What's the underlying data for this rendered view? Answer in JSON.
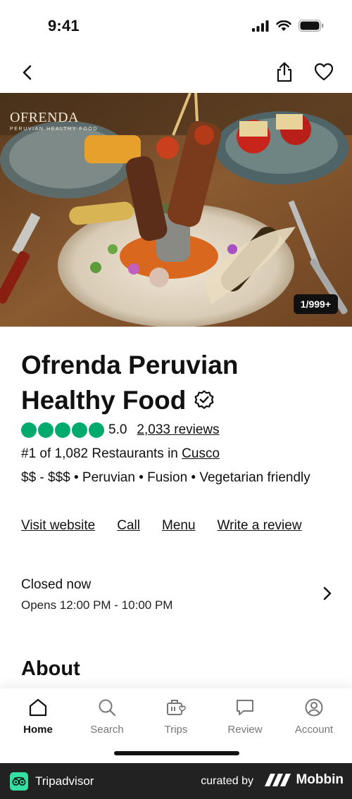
{
  "status_bar": {
    "time": "9:41",
    "icons": [
      "signal-icon",
      "wifi-icon",
      "battery-icon"
    ]
  },
  "nav": {
    "back_icon": "chevron-left-icon",
    "share_icon": "share-icon",
    "favorite_icon": "heart-icon"
  },
  "hero": {
    "photo_counter": "1/999+",
    "logo_text": "OFRENDA",
    "logo_subtext": "PERUVIAN HEALTHY FOOD"
  },
  "restaurant": {
    "name": "Ofrenda Peruvian Healthy Food",
    "verified_icon": "verified-badge-icon",
    "rating": "5.0",
    "rating_bubbles": 5,
    "review_count": "2,033 reviews",
    "ranking_prefix": "#1 of 1,082 Restaurants in ",
    "ranking_city": "Cusco",
    "tags": "$$ - $$$ • Peruvian • Fusion • Vegetarian friendly"
  },
  "actions": {
    "visit_website": "Visit website",
    "call": "Call",
    "menu": "Menu",
    "write_review": "Write a review"
  },
  "hours": {
    "status": "Closed now",
    "detail": "Opens 12:00 PM - 10:00 PM"
  },
  "about": {
    "heading": "About"
  },
  "tabs": [
    {
      "label": "Home",
      "icon": "home-icon",
      "active": true
    },
    {
      "label": "Search",
      "icon": "search-icon",
      "active": false
    },
    {
      "label": "Trips",
      "icon": "trips-icon",
      "active": false
    },
    {
      "label": "Review",
      "icon": "review-icon",
      "active": false
    },
    {
      "label": "Account",
      "icon": "account-icon",
      "active": false
    }
  ],
  "footer": {
    "brand": "Tripadvisor",
    "curated_by": "curated by",
    "curator": "Mobbin"
  },
  "colors": {
    "rating_green": "#00aa6c",
    "footer_bg": "#222222",
    "tripadvisor_badge": "#34e0a1"
  }
}
